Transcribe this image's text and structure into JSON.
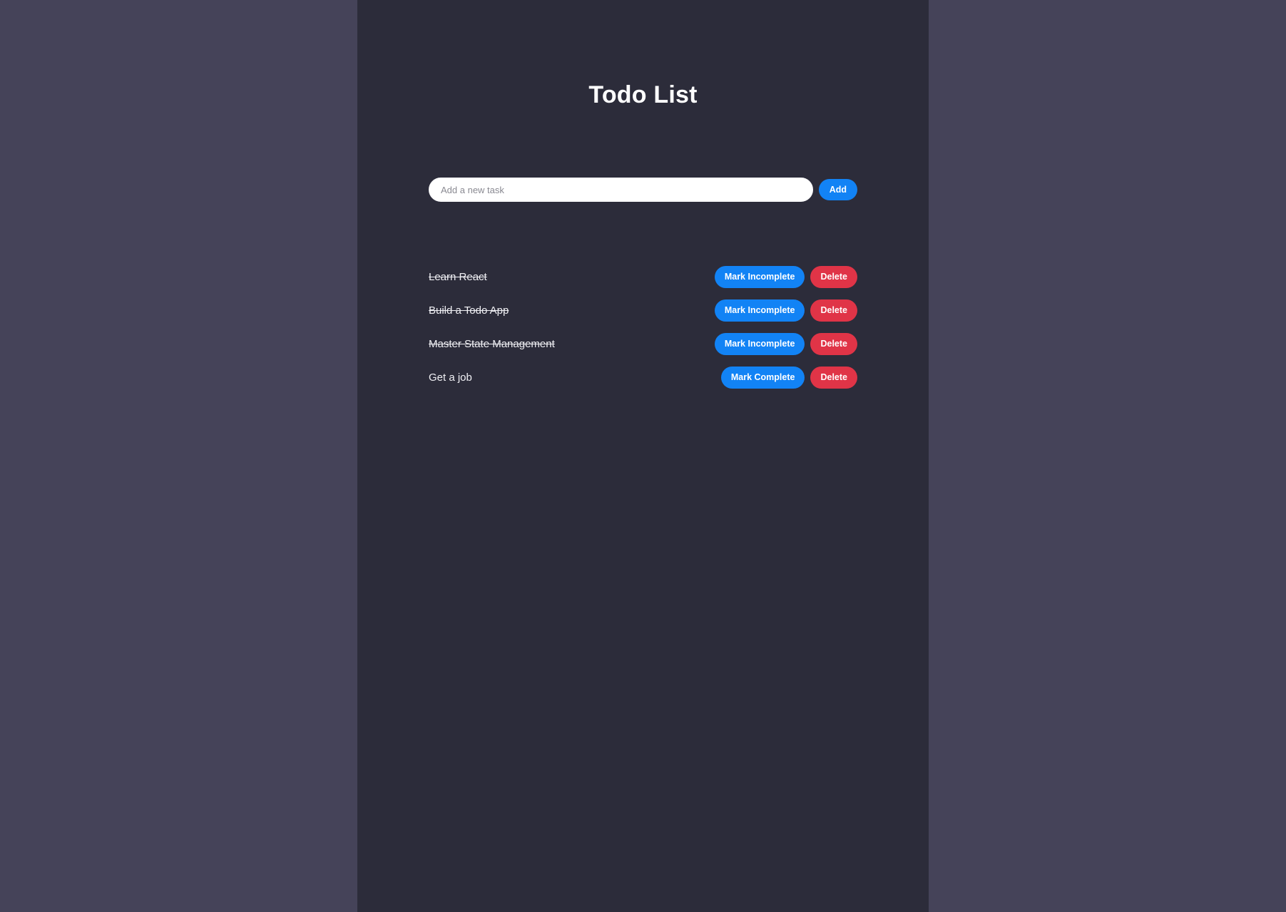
{
  "app": {
    "title": "Todo List",
    "background_outer": "#454359",
    "background_container": "#2c2c3a",
    "accent_blue": "#1283f5",
    "accent_red": "#e03447",
    "text_color": "#f0f0f4"
  },
  "add_form": {
    "placeholder": "Add a new task",
    "value": "",
    "add_label": "Add"
  },
  "labels": {
    "mark_complete": "Mark Complete",
    "mark_incomplete": "Mark Incomplete",
    "delete": "Delete"
  },
  "todos": [
    {
      "text": "Learn React",
      "completed": true,
      "toggle_label": "Mark Incomplete",
      "delete_label": "Delete"
    },
    {
      "text": "Build a Todo App",
      "completed": true,
      "toggle_label": "Mark Incomplete",
      "delete_label": "Delete"
    },
    {
      "text": "Master State Management",
      "completed": true,
      "toggle_label": "Mark Incomplete",
      "delete_label": "Delete"
    },
    {
      "text": "Get a job",
      "completed": false,
      "toggle_label": "Mark Complete",
      "delete_label": "Delete"
    }
  ]
}
